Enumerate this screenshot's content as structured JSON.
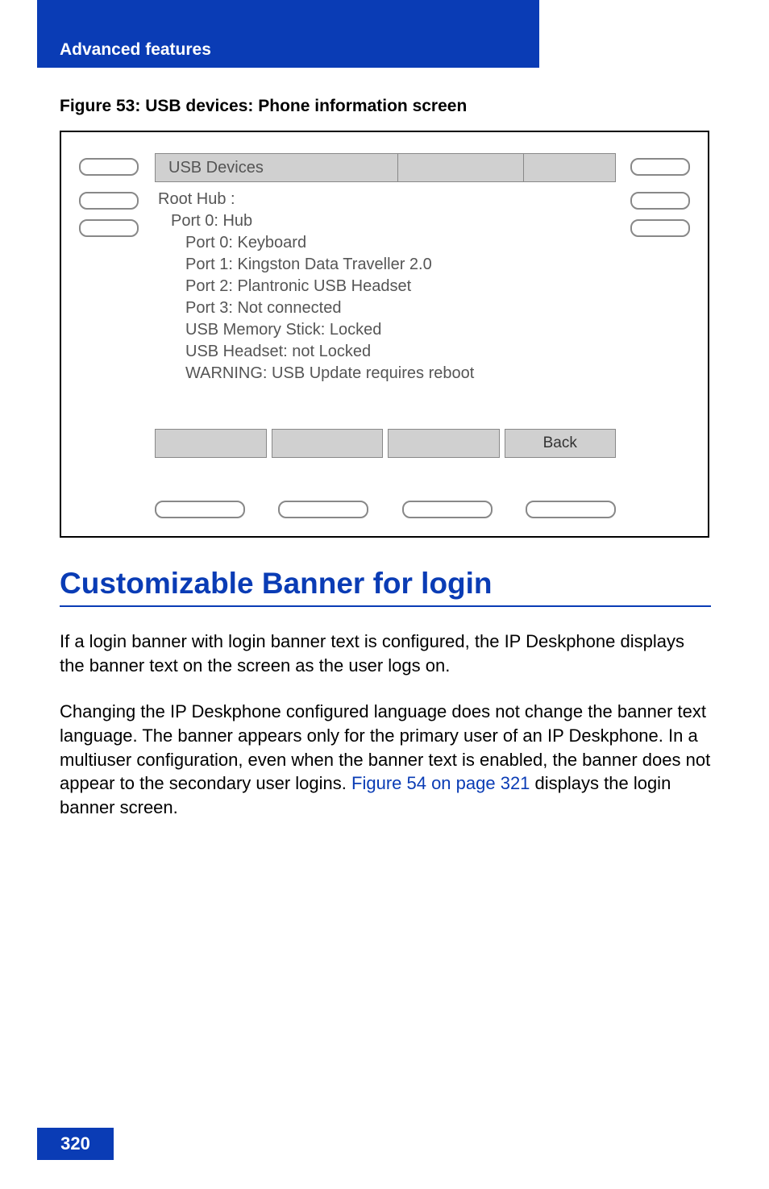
{
  "header": {
    "title": "Advanced features"
  },
  "figure": {
    "caption": "Figure 53: USB devices: Phone information screen",
    "screen_title": "USB Devices",
    "lines": [
      {
        "text": "Root Hub :",
        "indent": 0
      },
      {
        "text": "Port 0: Hub",
        "indent": 1
      },
      {
        "text": "Port 0: Keyboard",
        "indent": 2
      },
      {
        "text": "Port 1: Kingston Data Traveller 2.0",
        "indent": 2
      },
      {
        "text": "Port 2: Plantronic USB Headset",
        "indent": 2
      },
      {
        "text": "Port 3: Not connected",
        "indent": 2
      },
      {
        "text": "USB Memory Stick: Locked",
        "indent": 2
      },
      {
        "text": "USB Headset: not Locked",
        "indent": 2
      },
      {
        "text": "WARNING: USB Update requires reboot",
        "indent": 2
      }
    ],
    "softkeys": [
      "",
      "",
      "",
      "Back"
    ]
  },
  "section": {
    "heading": "Customizable Banner for login",
    "para1": "If a login banner with login banner text is configured, the IP Deskphone displays the banner text on the screen as the user logs on.",
    "para2_pre": "Changing the IP Deskphone configured language does not change the banner text language. The banner appears only for the primary user of an IP Deskphone. In a multiuser configuration, even when the banner text is enabled, the banner does not appear to the secondary user logins. ",
    "para2_xref": "Figure 54 on page 321",
    "para2_post": " displays the login banner screen."
  },
  "page_number": "320"
}
